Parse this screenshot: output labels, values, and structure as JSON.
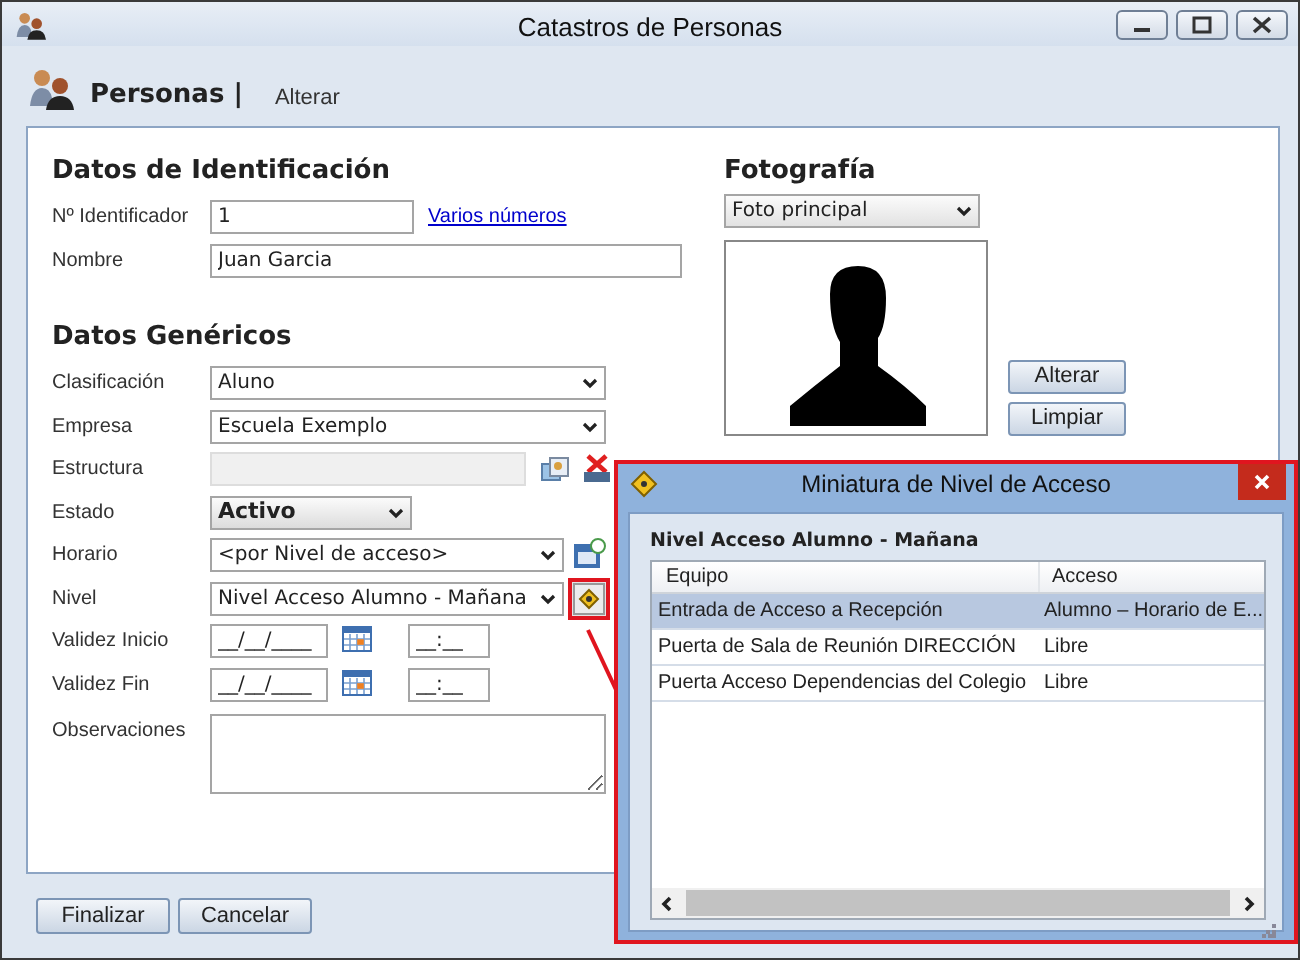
{
  "window": {
    "title": "Catastros de Personas"
  },
  "header": {
    "title": "Personas |",
    "action": "Alterar"
  },
  "identification": {
    "heading": "Datos de Identificación",
    "fields": [
      {
        "label": "Nº Identificador",
        "kind": "text",
        "value": "1",
        "link": "Varios números"
      },
      {
        "label": "Nombre",
        "kind": "text",
        "value": "Juan Garcia"
      }
    ]
  },
  "generic": {
    "heading": "Datos Genéricos",
    "fields": [
      {
        "label": "Clasificación",
        "kind": "select",
        "value": "Aluno"
      },
      {
        "label": "Empresa",
        "kind": "select",
        "value": "Escuela Exemplo"
      },
      {
        "label": "Estructura",
        "kind": "picker",
        "disabled": true,
        "tools": [
          {
            "kind": "structure"
          },
          {
            "kind": "clear"
          }
        ]
      },
      {
        "label": "Estado",
        "kind": "state-select",
        "value": "Activo"
      },
      {
        "label": "Horario",
        "kind": "select",
        "value": "<por Nivel de acceso>",
        "tools": [
          {
            "kind": "schedule"
          }
        ]
      },
      {
        "label": "Nivel",
        "kind": "select",
        "value": "Nivel Acceso Alumno - Mañana",
        "tools": [
          {
            "kind": "access-level"
          }
        ],
        "highlighted": true
      },
      {
        "label": "Validez Inicio",
        "kind": "date",
        "value": "__/__/____",
        "time": "__:__"
      },
      {
        "label": "Validez Fin",
        "kind": "date",
        "value": "__/__/____",
        "time": "__:__"
      },
      {
        "label": "Observaciones",
        "kind": "textarea"
      }
    ]
  },
  "photo": {
    "heading": "Fotografía",
    "select": "Foto principal",
    "buttons": [
      "Alterar",
      "Limpiar"
    ]
  },
  "footer": {
    "buttons": [
      "Finalizar",
      "Cancelar"
    ]
  },
  "popup": {
    "title": "Miniatura de Nivel de Acceso",
    "highlighted": true,
    "subtitle": "Nivel Acceso Alumno - Mañana",
    "columns": [
      "Equipo",
      "Acceso"
    ],
    "rows": [
      {
        "cells": [
          "Entrada de Acceso a Recepción",
          "Alumno – Horario de E..."
        ],
        "selected": true
      },
      {
        "cells": [
          "Puerta de Sala de Reunión DIRECCIÓN",
          "Libre"
        ],
        "selected": false
      },
      {
        "cells": [
          "Puerta Acceso Dependencias del Colegio",
          "Libre"
        ],
        "selected": false
      }
    ]
  }
}
